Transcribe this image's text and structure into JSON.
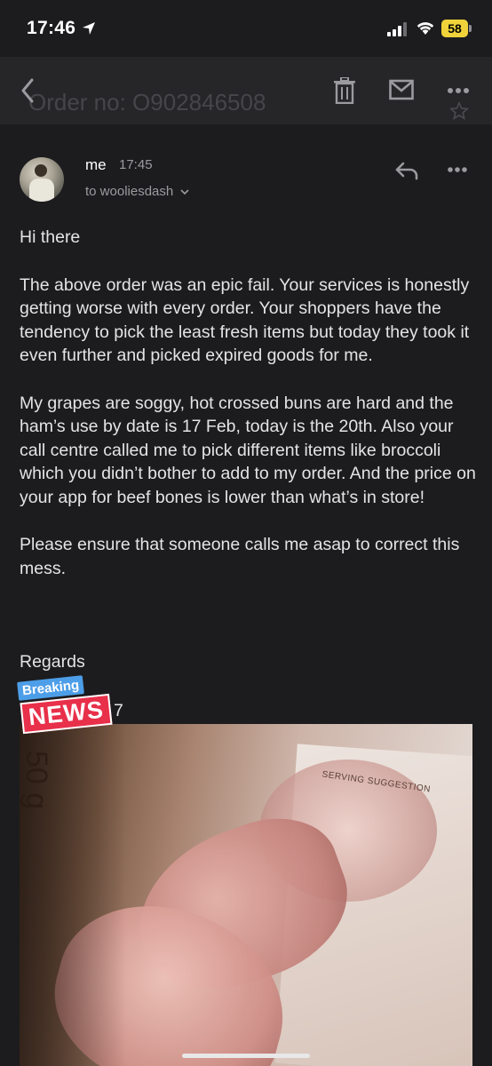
{
  "status_bar": {
    "time": "17:46",
    "battery": "58"
  },
  "toolbar": {
    "subject": "Order no: O902846508"
  },
  "message": {
    "sender": "me",
    "time": "17:45",
    "recipient": "to wooliesdash"
  },
  "body": {
    "greeting": "Hi there",
    "paragraph1": "The above order was an epic fail. Your services is honestly getting worse with every order. Your shoppers have the tendency to pick the least fresh items but today they took it even further and picked expired goods for me.",
    "paragraph2": "My grapes are soggy, hot crossed buns are hard and the ham’s use by date is 17 Feb, today is the 20th. Also your call centre called me to pick different items like broccoli which you didn’t bother to add to my order. And the price on your app for beef bones is lower than what’s in store!",
    "paragraph3": "Please ensure that someone calls me asap to correct this mess.",
    "closing": "Regards",
    "signature_fragment": "7"
  },
  "overlay": {
    "breaking": "Breaking",
    "news": "NEWS"
  },
  "photo": {
    "weight": "50 g",
    "serving": "SERVING SUGGESTION"
  },
  "icons": [
    "location-arrow-icon",
    "signal-icon",
    "wifi-icon",
    "back-chevron-icon",
    "trash-icon",
    "mail-icon",
    "more-horizontal-icon",
    "star-icon",
    "reply-icon"
  ]
}
